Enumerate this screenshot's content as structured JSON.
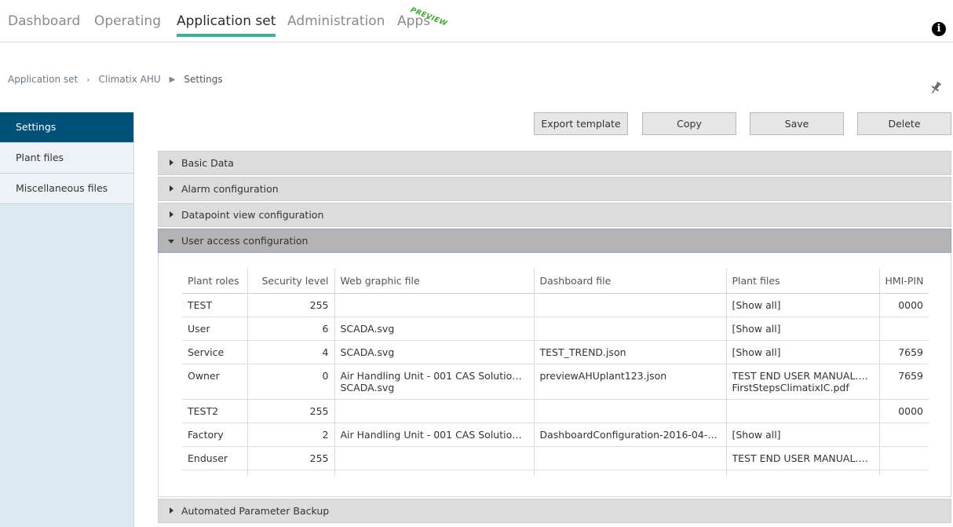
{
  "nav": {
    "tabs": [
      {
        "label": "Dashboard"
      },
      {
        "label": "Operating"
      },
      {
        "label": "Application set"
      },
      {
        "label": "Administration"
      },
      {
        "label": "Apps"
      }
    ],
    "apps_badge": "PREVIEW",
    "active_tab": "Application set",
    "info_icon": "info-icon"
  },
  "breadcrumb": {
    "items": [
      "Application set",
      "Climatix AHU",
      "Settings"
    ],
    "separator_1": "›",
    "separator_2": "▶"
  },
  "sidebar": {
    "items": [
      {
        "label": "Settings",
        "active": true
      },
      {
        "label": "Plant files",
        "active": false
      },
      {
        "label": "Miscellaneous files",
        "active": false
      }
    ],
    "active_color": "#005078"
  },
  "toolbar": {
    "export_label": "Export template",
    "copy_label": "Copy",
    "save_label": "Save",
    "delete_label": "Delete"
  },
  "sections": {
    "basic_data": "Basic Data",
    "alarm_configuration": "Alarm configuration",
    "datapoint_view": "Datapoint view configuration",
    "user_access": "User access configuration",
    "automated_backup": "Automated Parameter Backup"
  },
  "user_access_table": {
    "columns": [
      "Plant roles",
      "Security level",
      "Web graphic file",
      "Dashboard file",
      "Plant files",
      "HMI-PIN"
    ],
    "rows": [
      {
        "role": "TEST",
        "level": "255",
        "web": [
          "",
          ""
        ],
        "dashboard": "",
        "plant": [
          "[Show all]",
          ""
        ],
        "pin": "0000"
      },
      {
        "role": "User",
        "level": "6",
        "web": [
          "SCADA.svg",
          ""
        ],
        "dashboard": "",
        "plant": [
          "[Show all]",
          ""
        ],
        "pin": ""
      },
      {
        "role": "Service",
        "level": "4",
        "web": [
          "SCADA.svg",
          ""
        ],
        "dashboard": "TEST_TREND.json",
        "plant": [
          "[Show all]",
          ""
        ],
        "pin": "7659"
      },
      {
        "role": "Owner",
        "level": "0",
        "web": [
          "Air Handling Unit - 001 CAS Solution A...",
          "SCADA.svg"
        ],
        "dashboard": "previewAHUplant123.json",
        "plant": [
          "TEST END USER MANUAL.pdf",
          "FirstStepsClimatixIC.pdf"
        ],
        "pin": "7659"
      },
      {
        "role": "TEST2",
        "level": "255",
        "web": [
          "",
          ""
        ],
        "dashboard": "",
        "plant": [
          "",
          ""
        ],
        "pin": "0000"
      },
      {
        "role": "Factory",
        "level": "2",
        "web": [
          "Air Handling Unit - 001 CAS Solution A...",
          ""
        ],
        "dashboard": "DashboardConfiguration-2016-04-13...",
        "plant": [
          "[Show all]",
          ""
        ],
        "pin": ""
      },
      {
        "role": "Enduser",
        "level": "255",
        "web": [
          "",
          ""
        ],
        "dashboard": "",
        "plant": [
          "TEST END USER MANUAL.pdf",
          ""
        ],
        "pin": ""
      }
    ]
  },
  "colors": {
    "accent_underline": "#4fa59b",
    "preview_badge": "#3da834",
    "sidebar_bg": "#dde9f2"
  }
}
